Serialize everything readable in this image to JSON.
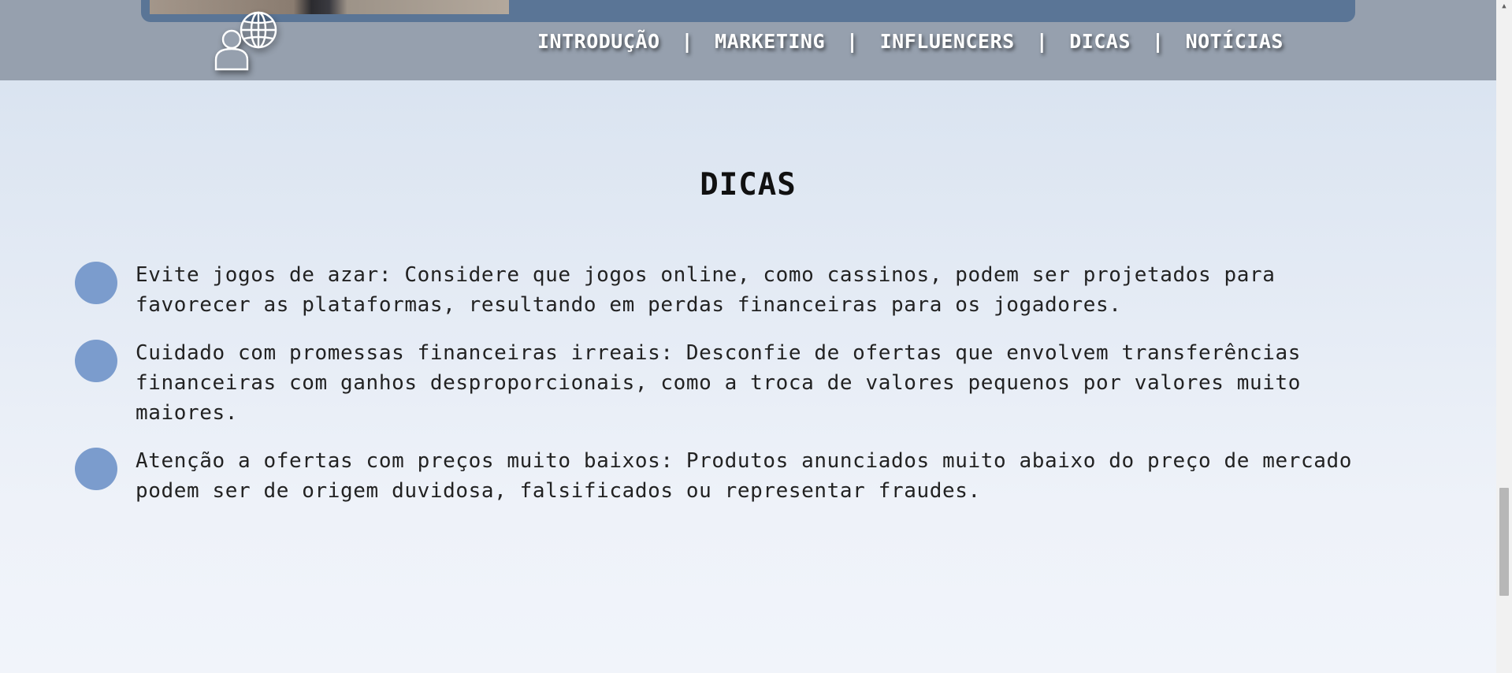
{
  "nav": {
    "items": [
      {
        "label": "INTRODUÇÃO"
      },
      {
        "label": "MARKETING"
      },
      {
        "label": "INFLUENCERS"
      },
      {
        "label": "DICAS"
      },
      {
        "label": "NOTÍCIAS"
      }
    ],
    "separator": "|"
  },
  "section": {
    "title": "DICAS",
    "tips": [
      {
        "text": "Evite jogos de azar: Considere que jogos online, como cassinos, podem ser projetados para favorecer as plataformas, resultando em perdas financeiras para os jogadores."
      },
      {
        "text": "Cuidado com promessas financeiras irreais: Desconfie de ofertas que envolvem transferências financeiras com ganhos desproporcionais, como a troca de valores pequenos por valores muito maiores."
      },
      {
        "text": "Atenção a ofertas com preços muito baixos: Produtos anunciados muito abaixo do preço de mercado podem ser de origem duvidosa, falsificados ou representar fraudes."
      }
    ]
  },
  "icons": {
    "logo": "person-globe-icon",
    "bullet": "circle-bullet-icon",
    "scroll_up": "scroll-up-arrow-icon"
  },
  "colors": {
    "header_bg": "#96a0ae",
    "banner_bg": "#5a7596",
    "bullet": "#7b9ccd",
    "nav_text": "#ffffff"
  }
}
